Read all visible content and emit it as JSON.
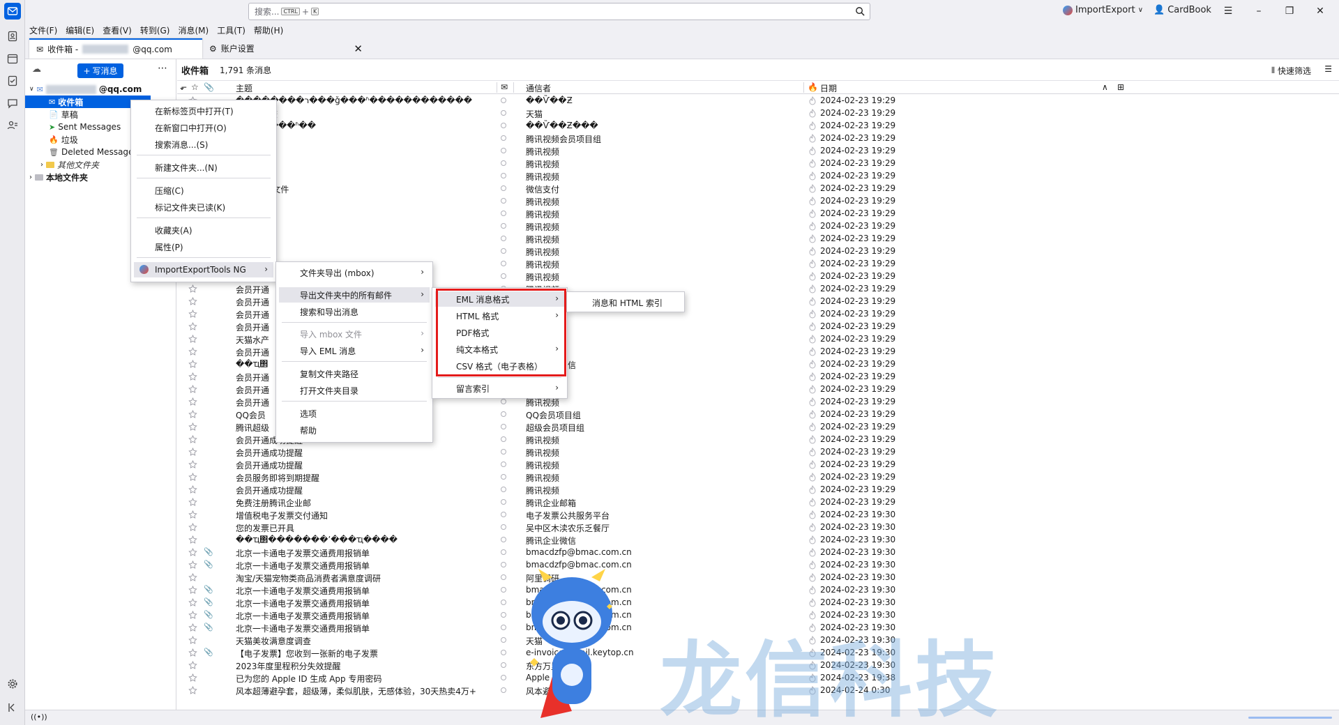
{
  "search": {
    "placeholder": "搜索...",
    "kbd1": "CTRL",
    "plus": "+",
    "kbd2": "K"
  },
  "toolbar": {
    "import_export": "ImportExport",
    "cardbook": "CardBook"
  },
  "menubar": [
    "文件(F)",
    "编辑(E)",
    "查看(V)",
    "转到(G)",
    "消息(M)",
    "工具(T)",
    "帮助(H)"
  ],
  "tabs": {
    "inbox_prefix": "收件箱 -",
    "inbox_suffix": "@qq.com",
    "settings": "账户设置"
  },
  "folder_pane": {
    "new_message": "写消息",
    "account_suffix": "@qq.com",
    "folders": [
      "收件箱",
      "草稿",
      "Sent Messages",
      "垃圾",
      "Deleted Messages",
      "其他文件夹"
    ],
    "local_folders": "本地文件夹"
  },
  "thread_header": {
    "title": "收件箱",
    "count": "1,791 条消息",
    "quick_filter": "快速筛选"
  },
  "columns": {
    "subject": "主题",
    "correspondent": "通信者",
    "date": "日期"
  },
  "context_menu": {
    "items": [
      "在新标签页中打开(T)",
      "在新窗口中打开(O)",
      "搜索消息...(S)",
      "新建文件夹...(N)",
      "压缩(C)",
      "标记文件夹已读(K)",
      "收藏夹(A)",
      "属性(P)",
      "ImportExportTools NG"
    ]
  },
  "submenu": {
    "items": [
      "文件夹导出 (mbox)",
      "导出文件夹中的所有邮件",
      "搜索和导出消息",
      "导入 mbox 文件",
      "导入 EML 消息",
      "复制文件夹路径",
      "打开文件夹目录",
      "选项",
      "帮助"
    ]
  },
  "format_menu": {
    "items": [
      "EML 消息格式",
      "HTML 格式",
      "PDF格式",
      "纯文本格式",
      "CSV 格式（电子表格）",
      "留言索引"
    ]
  },
  "eml_menu": {
    "items": [
      "消息和 HTML 索引"
    ]
  },
  "messages": [
    {
      "s": "��������ר���ǧ���ʱ������������",
      "c": "��Ѷ��Ƶ",
      "d": "2024-02-23 19:29",
      "a": false
    },
    {
      "s": "满意度调查",
      "c": "天猫",
      "d": "2024-02-23 19:29",
      "a": false
    },
    {
      "s": "���ǽ���ʱ��",
      "c": "��Ѷ��Ƶ���",
      "d": "2024-02-23 19:29",
      "a": false
    },
    {
      "s": "VIP通知",
      "c": "腾讯视频会员项目组",
      "d": "2024-02-23 19:29",
      "a": false
    },
    {
      "s": "成功提醒",
      "c": "腾讯视频",
      "d": "2024-02-23 19:29",
      "a": false
    },
    {
      "s": "成功提醒",
      "c": "腾讯视频",
      "d": "2024-02-23 19:29",
      "a": false
    },
    {
      "s": "成功提醒",
      "c": "腾讯视频",
      "d": "2024-02-23 19:29",
      "a": false
    },
    {
      "s": "-账单流水文件",
      "c": "微信支付",
      "d": "2024-02-23 19:29",
      "a": false
    },
    {
      "s": "成功提醒",
      "c": "腾讯视频",
      "d": "2024-02-23 19:29",
      "a": false
    },
    {
      "s": "成功提醒",
      "c": "腾讯视频",
      "d": "2024-02-23 19:29",
      "a": false
    },
    {
      "s": "成功提醒",
      "c": "腾讯视频",
      "d": "2024-02-23 19:29",
      "a": false
    },
    {
      "s": "付提醒",
      "c": "腾讯视频",
      "d": "2024-02-23 19:29",
      "a": false
    },
    {
      "s": "成功提醒",
      "c": "腾讯视频",
      "d": "2024-02-23 19:29",
      "a": false
    },
    {
      "s": "",
      "c": "腾讯视频",
      "d": "2024-02-23 19:29",
      "a": false
    },
    {
      "s": "",
      "c": "腾讯视频",
      "d": "2024-02-23 19:29",
      "a": false
    },
    {
      "s": "会员开通",
      "c": "腾讯视频",
      "d": "2024-02-23 19:29",
      "a": false
    },
    {
      "s": "会员开通",
      "c": "腾讯视频",
      "d": "2024-02-23 19:29",
      "a": false
    },
    {
      "s": "会员开通",
      "c": "腾讯视频",
      "d": "2024-02-23 19:29",
      "a": false
    },
    {
      "s": "会员开通",
      "c": "腾讯视频",
      "d": "2024-02-23 19:29",
      "a": false
    },
    {
      "s": "天猫水产",
      "c": "天猫",
      "d": "2024-02-23 19:29",
      "a": false
    },
    {
      "s": "会员开通",
      "c": "腾讯视频",
      "d": "2024-02-23 19:29",
      "a": false
    },
    {
      "s": "��ҵ΢",
      "c": "腾讯企业微信",
      "d": "2024-02-23 19:29",
      "a": false
    },
    {
      "s": "会员开通",
      "c": "腾讯视频",
      "d": "2024-02-23 19:29",
      "a": false
    },
    {
      "s": "会员开通",
      "c": "腾讯视频",
      "d": "2024-02-23 19:29",
      "a": false
    },
    {
      "s": "会员开通",
      "c": "腾讯视频",
      "d": "2024-02-23 19:29",
      "a": false
    },
    {
      "s": "QQ会员",
      "c": "QQ会员项目组",
      "d": "2024-02-23 19:29",
      "a": false
    },
    {
      "s": "腾讯超级",
      "c": "超级会员项目组",
      "d": "2024-02-23 19:29",
      "a": false
    },
    {
      "s": "会员开通成功提醒",
      "c": "腾讯视频",
      "d": "2024-02-23 19:29",
      "a": false
    },
    {
      "s": "会员开通成功提醒",
      "c": "腾讯视频",
      "d": "2024-02-23 19:29",
      "a": false
    },
    {
      "s": "会员开通成功提醒",
      "c": "腾讯视频",
      "d": "2024-02-23 19:29",
      "a": false
    },
    {
      "s": "会员服务即将到期提醒",
      "c": "腾讯视频",
      "d": "2024-02-23 19:29",
      "a": false
    },
    {
      "s": "会员开通成功提醒",
      "c": "腾讯视频",
      "d": "2024-02-23 19:29",
      "a": false
    },
    {
      "s": "免费注册腾讯企业邮",
      "c": "腾讯企业邮箱",
      "d": "2024-02-23 19:29",
      "a": false
    },
    {
      "s": "增值税电子发票交付通知",
      "c": "电子发票公共服务平台",
      "d": "2024-02-23 19:30",
      "a": false
    },
    {
      "s": "您的发票已开具",
      "c": "吴中区木渎农乐乏餐厅",
      "d": "2024-02-23 19:30",
      "a": false
    },
    {
      "s": "��ҵ΢�������ʼ���ҵ����",
      "c": "腾讯企业微信",
      "d": "2024-02-23 19:30",
      "a": false
    },
    {
      "s": "北京一卡通电子发票交通费用报销单",
      "c": "bmacdzfp@bmac.com.cn",
      "d": "2024-02-23 19:30",
      "a": true
    },
    {
      "s": "北京一卡通电子发票交通费用报销单",
      "c": "bmacdzfp@bmac.com.cn",
      "d": "2024-02-23 19:30",
      "a": true
    },
    {
      "s": "淘宝/天猫宠物类商品消费者满意度调研",
      "c": "阿里调研",
      "d": "2024-02-23 19:30",
      "a": false
    },
    {
      "s": "北京一卡通电子发票交通费用报销单",
      "c": "bmacdzfp@bmac.com.cn",
      "d": "2024-02-23 19:30",
      "a": true
    },
    {
      "s": "北京一卡通电子发票交通费用报销单",
      "c": "bmacdzfp@bmac.com.cn",
      "d": "2024-02-23 19:30",
      "a": true
    },
    {
      "s": "北京一卡通电子发票交通费用报销单",
      "c": "bmacdzfp@bmac.com.cn",
      "d": "2024-02-23 19:30",
      "a": true
    },
    {
      "s": "北京一卡通电子发票交通费用报销单",
      "c": "bmacdzfp@bmac.com.cn",
      "d": "2024-02-23 19:30",
      "a": true
    },
    {
      "s": "天猫美妆满意度调查",
      "c": "天猫",
      "d": "2024-02-23 19:30",
      "a": false
    },
    {
      "s": "【电子发票】您收到一张新的电子发票",
      "c": "e-invoice@mail.keytop.cn",
      "d": "2024-02-23 19:30",
      "a": true
    },
    {
      "s": "2023年度里程积分失效提醒",
      "c": "东方万里行",
      "d": "2024-02-23 19:30",
      "a": false
    },
    {
      "s": "已为您的 Apple ID 生成 App 专用密码",
      "c": "Apple",
      "d": "2024-02-23 19:38",
      "a": false
    },
    {
      "s": "风本超薄避孕套，超级薄，柔似肌肤，无感体验，30天热卖4万+",
      "c": "风本避孕套",
      "d": "2024-02-24 0:30",
      "a": false
    }
  ],
  "watermark": "龙信科技",
  "colors": {
    "accent": "#0061e0",
    "highlight_box": "#e41b1b"
  }
}
